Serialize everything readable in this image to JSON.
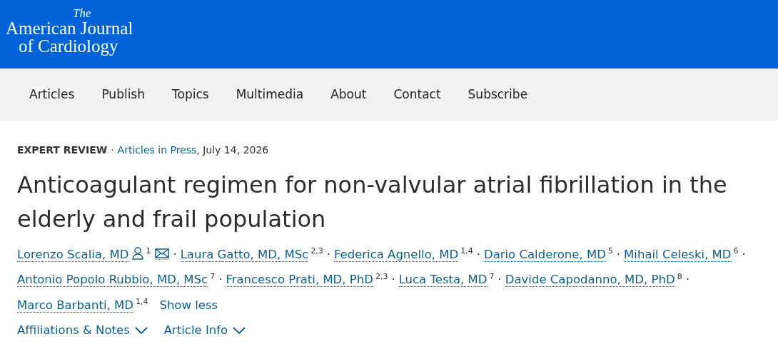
{
  "logo": {
    "article": "The",
    "line_1": "American Journal",
    "line_2": "of Cardiology"
  },
  "nav": [
    {
      "label": "Articles"
    },
    {
      "label": "Publish"
    },
    {
      "label": "Topics"
    },
    {
      "label": "Multimedia"
    },
    {
      "label": "About"
    },
    {
      "label": "Contact"
    },
    {
      "label": "Subscribe"
    }
  ],
  "meta": {
    "type": "EXPERT REVIEW",
    "separator": "·",
    "section": "Articles in Press",
    "date": ", July 14, 2026"
  },
  "title": "Anticoagulant regimen for non-valvular atrial fibrillation in the elderly and frail population",
  "author_lines": [
    [
      {
        "name": "Lorenzo Scalia, MD",
        "contact_icons": true,
        "affiliations": "1",
        "separator": "·"
      },
      {
        "name": "Laura Gatto, MD, MSc",
        "contact_icons": false,
        "affiliations": "2,3",
        "separator": "·"
      },
      {
        "name": "Federica Agnello, MD",
        "contact_icons": false,
        "affiliations": "1,4",
        "separator": "·"
      },
      {
        "name": "Dario Calderone, MD",
        "contact_icons": false,
        "affiliations": "5",
        "separator": "·"
      },
      {
        "name": "Mihail Celeski, MD",
        "contact_icons": false,
        "affiliations": "6",
        "separator": "·"
      }
    ],
    [
      {
        "name": "Antonio Popolo Rubbio, MD, MSc",
        "contact_icons": false,
        "affiliations": "7",
        "separator": "·"
      },
      {
        "name": "Francesco Prati, MD, PhD",
        "contact_icons": false,
        "affiliations": "2,3",
        "separator": "·"
      },
      {
        "name": "Luca Testa, MD",
        "contact_icons": false,
        "affiliations": "7",
        "separator": "·"
      },
      {
        "name": "Davide Capodanno, MD, PhD",
        "contact_icons": false,
        "affiliations": "8",
        "separator": "·"
      }
    ],
    [
      {
        "name": "Marco Barbanti, MD",
        "contact_icons": false,
        "affiliations": "1,4"
      }
    ]
  ],
  "show_less": "Show less",
  "toggles": [
    {
      "label": "Affiliations & Notes",
      "expanded": false
    },
    {
      "label": "Article Info",
      "expanded": false
    }
  ]
}
